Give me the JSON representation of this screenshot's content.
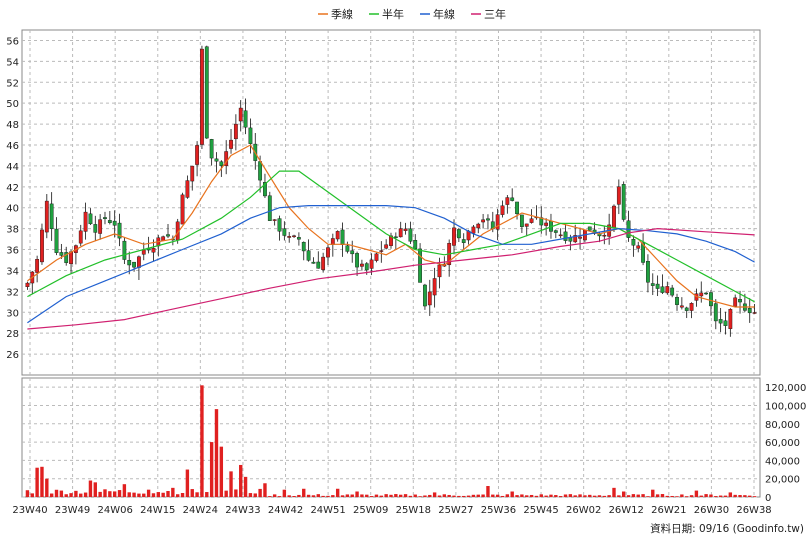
{
  "chart_data": {
    "type": "candlestick",
    "legend": [
      {
        "name": "季線",
        "color": "#e8731e"
      },
      {
        "name": "半年",
        "color": "#22c02a"
      },
      {
        "name": "年線",
        "color": "#2060d0"
      },
      {
        "name": "三年",
        "color": "#d02070"
      }
    ],
    "price_axis": {
      "min": 24,
      "max": 57,
      "ticks": [
        26,
        28,
        30,
        32,
        34,
        36,
        38,
        40,
        42,
        44,
        46,
        48,
        50,
        52,
        54,
        56
      ]
    },
    "volume_axis": {
      "min": 0,
      "max": 130000,
      "ticks": [
        0,
        20000,
        40000,
        60000,
        80000,
        100000,
        120000
      ],
      "tick_labels": [
        "0",
        "20,000",
        "40,000",
        "60,000",
        "80,000",
        "100,000",
        "120,000"
      ]
    },
    "x_labels": [
      "23W40",
      "23W49",
      "24W06",
      "24W15",
      "24W24",
      "24W33",
      "24W42",
      "24W51",
      "25W09",
      "25W18",
      "25W27",
      "25W36",
      "25W45",
      "26W02",
      "26W12",
      "26W21",
      "26W30",
      "26W38"
    ],
    "footer": "資料日期: 09/16  (Goodinfo.tw)",
    "up_color": "#e02020",
    "down_color": "#20a040",
    "key_points": [
      {
        "w": 0,
        "c": 32.8
      },
      {
        "w": 2,
        "c": 35
      },
      {
        "w": 4,
        "c": 40.5
      },
      {
        "w": 6,
        "c": 36
      },
      {
        "w": 8,
        "c": 35
      },
      {
        "w": 10,
        "c": 36.5
      },
      {
        "w": 12,
        "c": 39.5
      },
      {
        "w": 14,
        "c": 38
      },
      {
        "w": 16,
        "c": 39
      },
      {
        "w": 18,
        "c": 38.5
      },
      {
        "w": 20,
        "c": 35
      },
      {
        "w": 22,
        "c": 34.5
      },
      {
        "w": 24,
        "c": 36
      },
      {
        "w": 26,
        "c": 36.5
      },
      {
        "w": 28,
        "c": 37.5
      },
      {
        "w": 30,
        "c": 37
      },
      {
        "w": 32,
        "c": 41
      },
      {
        "w": 34,
        "c": 44
      },
      {
        "w": 35,
        "c": 46
      },
      {
        "w": 36,
        "c": 55
      },
      {
        "w": 37,
        "c": 47
      },
      {
        "w": 38,
        "c": 45
      },
      {
        "w": 40,
        "c": 44
      },
      {
        "w": 42,
        "c": 46.5
      },
      {
        "w": 44,
        "c": 49.5
      },
      {
        "w": 46,
        "c": 46
      },
      {
        "w": 48,
        "c": 43
      },
      {
        "w": 50,
        "c": 39
      },
      {
        "w": 52,
        "c": 38
      },
      {
        "w": 54,
        "c": 37
      },
      {
        "w": 56,
        "c": 37
      },
      {
        "w": 58,
        "c": 35
      },
      {
        "w": 60,
        "c": 34.5
      },
      {
        "w": 62,
        "c": 36
      },
      {
        "w": 64,
        "c": 37.5
      },
      {
        "w": 66,
        "c": 36
      },
      {
        "w": 68,
        "c": 34.5
      },
      {
        "w": 70,
        "c": 34
      },
      {
        "w": 72,
        "c": 35.5
      },
      {
        "w": 74,
        "c": 36.5
      },
      {
        "w": 76,
        "c": 37.5
      },
      {
        "w": 78,
        "c": 38
      },
      {
        "w": 80,
        "c": 36
      },
      {
        "w": 82,
        "c": 30.5
      },
      {
        "w": 84,
        "c": 33.5
      },
      {
        "w": 86,
        "c": 35
      },
      {
        "w": 88,
        "c": 38
      },
      {
        "w": 90,
        "c": 37
      },
      {
        "w": 92,
        "c": 38.5
      },
      {
        "w": 94,
        "c": 39
      },
      {
        "w": 96,
        "c": 38
      },
      {
        "w": 98,
        "c": 40.5
      },
      {
        "w": 100,
        "c": 41
      },
      {
        "w": 102,
        "c": 38
      },
      {
        "w": 104,
        "c": 39
      },
      {
        "w": 106,
        "c": 38.5
      },
      {
        "w": 108,
        "c": 38
      },
      {
        "w": 110,
        "c": 37.5
      },
      {
        "w": 112,
        "c": 37
      },
      {
        "w": 114,
        "c": 37.5
      },
      {
        "w": 116,
        "c": 38
      },
      {
        "w": 118,
        "c": 37.5
      },
      {
        "w": 120,
        "c": 38
      },
      {
        "w": 122,
        "c": 42
      },
      {
        "w": 123,
        "c": 38.5
      },
      {
        "w": 124,
        "c": 37
      },
      {
        "w": 126,
        "c": 36
      },
      {
        "w": 128,
        "c": 33
      },
      {
        "w": 130,
        "c": 32
      },
      {
        "w": 132,
        "c": 32.5
      },
      {
        "w": 134,
        "c": 31
      },
      {
        "w": 136,
        "c": 30.5
      },
      {
        "w": 138,
        "c": 31.5
      },
      {
        "w": 140,
        "c": 32
      },
      {
        "w": 142,
        "c": 29
      },
      {
        "w": 144,
        "c": 28.8
      },
      {
        "w": 146,
        "c": 31
      },
      {
        "w": 148,
        "c": 30.5
      },
      {
        "w": 150,
        "c": 30
      }
    ],
    "volume_spikes": [
      {
        "w": 2,
        "v": 32000
      },
      {
        "w": 3,
        "v": 33000
      },
      {
        "w": 4,
        "v": 20000
      },
      {
        "w": 13,
        "v": 18000
      },
      {
        "w": 14,
        "v": 16000
      },
      {
        "w": 20,
        "v": 14000
      },
      {
        "w": 25,
        "v": 8000
      },
      {
        "w": 30,
        "v": 10000
      },
      {
        "w": 33,
        "v": 30000
      },
      {
        "w": 36,
        "v": 122000
      },
      {
        "w": 38,
        "v": 60000
      },
      {
        "w": 39,
        "v": 96000
      },
      {
        "w": 40,
        "v": 55000
      },
      {
        "w": 42,
        "v": 28000
      },
      {
        "w": 44,
        "v": 35000
      },
      {
        "w": 45,
        "v": 22000
      },
      {
        "w": 49,
        "v": 15000
      },
      {
        "w": 53,
        "v": 8000
      },
      {
        "w": 57,
        "v": 9000
      },
      {
        "w": 64,
        "v": 9000
      },
      {
        "w": 68,
        "v": 6000
      },
      {
        "w": 84,
        "v": 5000
      },
      {
        "w": 95,
        "v": 12000
      },
      {
        "w": 100,
        "v": 6000
      },
      {
        "w": 121,
        "v": 10000
      },
      {
        "w": 123,
        "v": 6000
      },
      {
        "w": 129,
        "v": 8000
      },
      {
        "w": 138,
        "v": 7000
      },
      {
        "w": 145,
        "v": 5000
      }
    ],
    "ma_quarter": [
      [
        0,
        33
      ],
      [
        6,
        35
      ],
      [
        12,
        36.5
      ],
      [
        18,
        37.5
      ],
      [
        24,
        36.5
      ],
      [
        30,
        37
      ],
      [
        34,
        39.5
      ],
      [
        38,
        42.5
      ],
      [
        42,
        45
      ],
      [
        46,
        46
      ],
      [
        50,
        43
      ],
      [
        54,
        40
      ],
      [
        58,
        38
      ],
      [
        62,
        36.5
      ],
      [
        66,
        36.5
      ],
      [
        70,
        36
      ],
      [
        74,
        35.5
      ],
      [
        78,
        36.5
      ],
      [
        82,
        35
      ],
      [
        86,
        34.5
      ],
      [
        90,
        36
      ],
      [
        94,
        37.5
      ],
      [
        98,
        38.5
      ],
      [
        102,
        39.5
      ],
      [
        106,
        39
      ],
      [
        110,
        38.5
      ],
      [
        114,
        38
      ],
      [
        118,
        37.5
      ],
      [
        122,
        38
      ],
      [
        126,
        37
      ],
      [
        130,
        35
      ],
      [
        134,
        33
      ],
      [
        138,
        31.5
      ],
      [
        142,
        31
      ],
      [
        146,
        30.5
      ],
      [
        150,
        30.5
      ]
    ],
    "ma_half": [
      [
        0,
        31.5
      ],
      [
        8,
        33.5
      ],
      [
        16,
        35
      ],
      [
        24,
        36
      ],
      [
        32,
        37
      ],
      [
        40,
        39
      ],
      [
        46,
        41
      ],
      [
        52,
        43.5
      ],
      [
        56,
        43.5
      ],
      [
        62,
        41.5
      ],
      [
        68,
        39.5
      ],
      [
        74,
        37.5
      ],
      [
        80,
        36
      ],
      [
        86,
        35.5
      ],
      [
        92,
        36
      ],
      [
        98,
        36.5
      ],
      [
        104,
        37.5
      ],
      [
        110,
        38.5
      ],
      [
        116,
        38.5
      ],
      [
        122,
        38
      ],
      [
        128,
        36.5
      ],
      [
        134,
        35
      ],
      [
        140,
        33.5
      ],
      [
        146,
        32
      ],
      [
        150,
        31
      ]
    ],
    "ma_year": [
      [
        0,
        29
      ],
      [
        8,
        31.5
      ],
      [
        16,
        33
      ],
      [
        24,
        34.5
      ],
      [
        32,
        36
      ],
      [
        40,
        37.5
      ],
      [
        46,
        39
      ],
      [
        52,
        40
      ],
      [
        58,
        40.2
      ],
      [
        66,
        40.2
      ],
      [
        74,
        40.2
      ],
      [
        80,
        40
      ],
      [
        86,
        39
      ],
      [
        92,
        37.5
      ],
      [
        98,
        36.5
      ],
      [
        104,
        36.5
      ],
      [
        110,
        37
      ],
      [
        116,
        37.5
      ],
      [
        122,
        38
      ],
      [
        128,
        37.8
      ],
      [
        134,
        37.5
      ],
      [
        140,
        36.8
      ],
      [
        146,
        35.8
      ],
      [
        150,
        34.8
      ]
    ],
    "ma_3y": [
      [
        0,
        28.4
      ],
      [
        10,
        28.8
      ],
      [
        20,
        29.3
      ],
      [
        30,
        30.3
      ],
      [
        40,
        31.3
      ],
      [
        50,
        32.3
      ],
      [
        60,
        33.2
      ],
      [
        70,
        33.8
      ],
      [
        80,
        34.5
      ],
      [
        90,
        35
      ],
      [
        100,
        35.5
      ],
      [
        110,
        36.3
      ],
      [
        118,
        36.8
      ],
      [
        124,
        37.6
      ],
      [
        130,
        38
      ],
      [
        140,
        37.7
      ],
      [
        150,
        37.4
      ]
    ]
  }
}
